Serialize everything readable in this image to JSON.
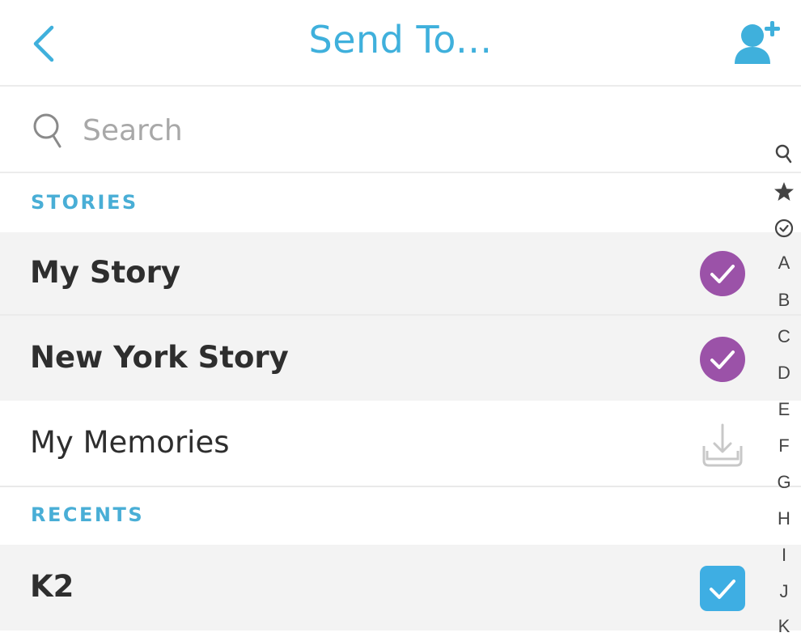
{
  "header": {
    "title": "Send To...",
    "back_icon": "chevron-left-icon",
    "add_friend_icon": "add-friend-icon",
    "accent_color": "#3fb0dc"
  },
  "search": {
    "placeholder": "Search",
    "value": "",
    "icon": "search-icon"
  },
  "sections": [
    {
      "title": "STORIES",
      "items": [
        {
          "label": "My Story",
          "bold": true,
          "control": "check-circle",
          "selected": true
        },
        {
          "label": "New York Story",
          "bold": true,
          "control": "check-circle",
          "selected": true
        },
        {
          "label": "My Memories",
          "bold": false,
          "control": "save-to-memories",
          "selected": false
        }
      ]
    },
    {
      "title": "RECENTS",
      "items": [
        {
          "label": "K2",
          "bold": true,
          "control": "check-box",
          "selected": true
        }
      ]
    }
  ],
  "index_rail": [
    "search",
    "star",
    "check",
    "A",
    "B",
    "C",
    "D",
    "E",
    "F",
    "G",
    "H",
    "I",
    "J",
    "K"
  ],
  "colors": {
    "story_selected": "#9b52a8",
    "friend_selected": "#3eaee3",
    "section_title": "#49aed6",
    "row_selected_bg": "#f3f3f3"
  }
}
